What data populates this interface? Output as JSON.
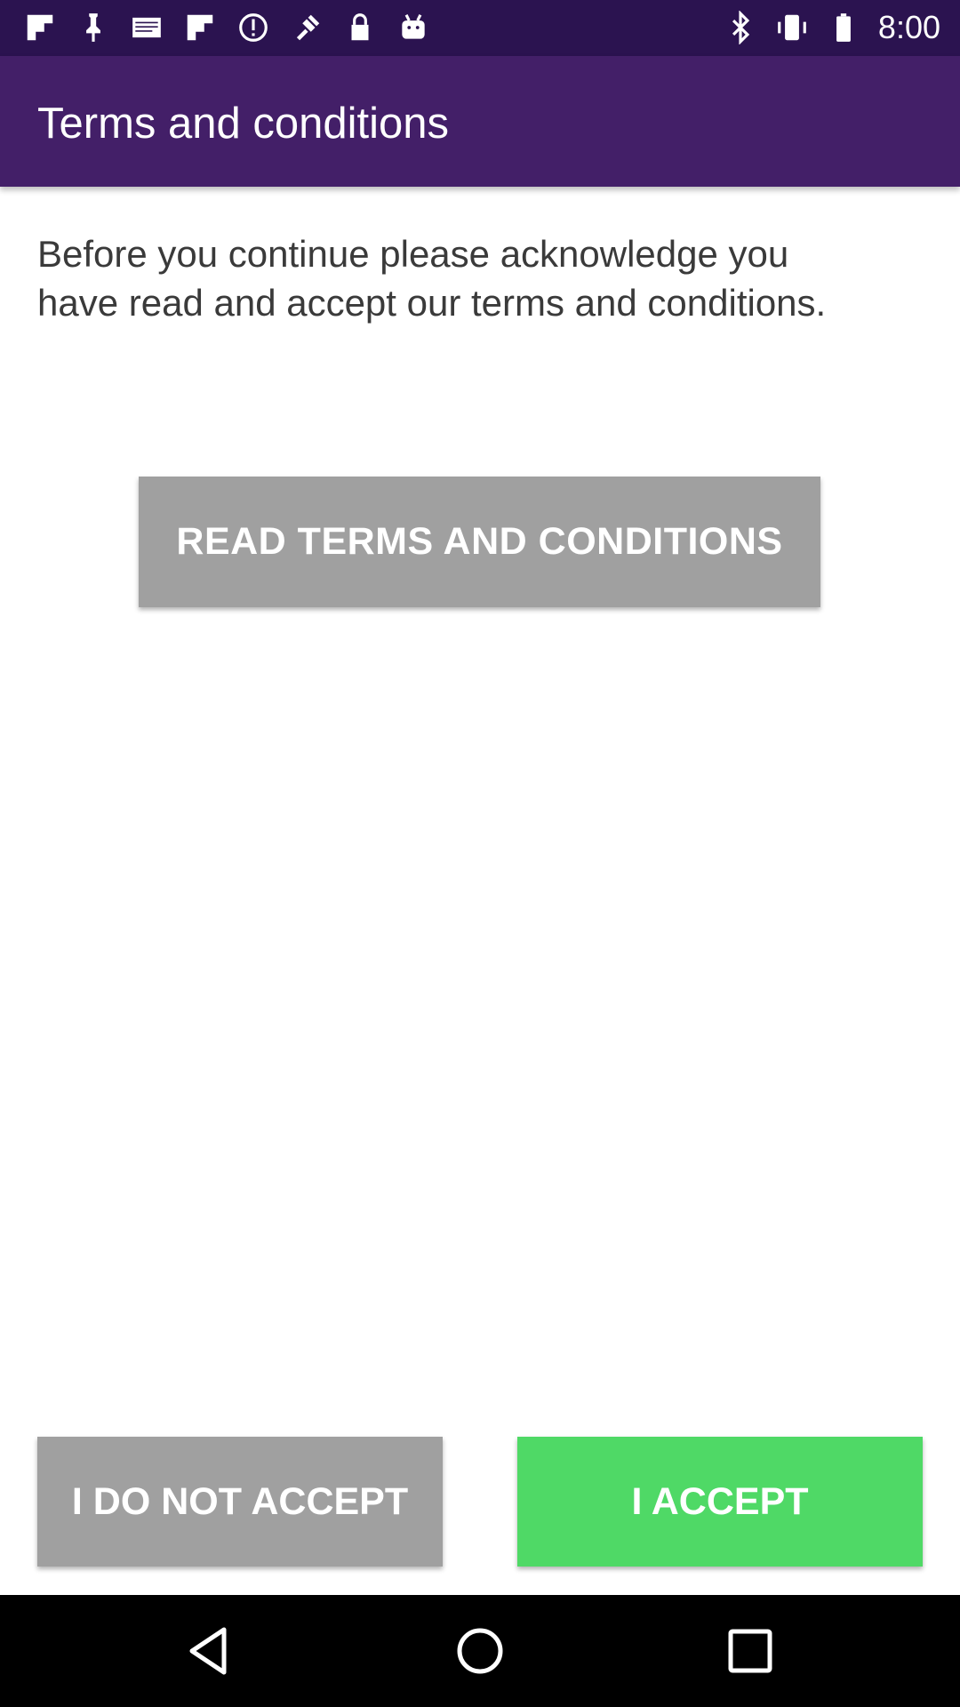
{
  "status_bar": {
    "time": "8:00",
    "left_icons": [
      "flipboard-icon",
      "pin-icon",
      "mail-icon",
      "flipboard-icon",
      "sync-icon",
      "fake-gps-icon",
      "lock-icon",
      "android-icon"
    ],
    "right_icons": [
      "bluetooth-icon",
      "vibrate-icon",
      "battery-icon"
    ]
  },
  "app_bar": {
    "title": "Terms and conditions",
    "color": "#431f68"
  },
  "content": {
    "intro": "Before you continue please acknowledge you have read and accept our terms and conditions.",
    "read_button_label": "READ TERMS AND CONDITIONS"
  },
  "actions": {
    "decline_label": "I DO NOT ACCEPT",
    "accept_label": "I ACCEPT",
    "accept_color": "#4fd966",
    "decline_color": "#a0a0a0"
  },
  "nav_bar": {
    "icons": [
      "back-icon",
      "home-icon",
      "recents-icon"
    ]
  }
}
